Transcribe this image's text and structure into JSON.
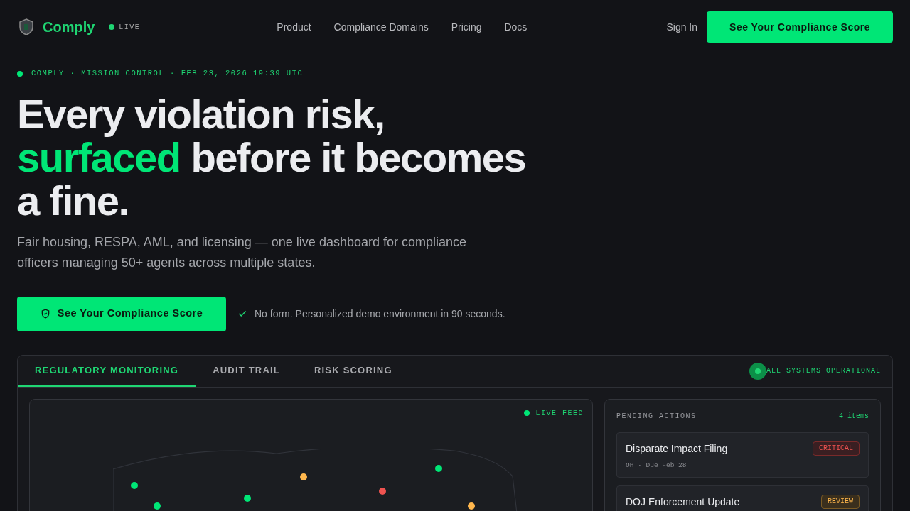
{
  "nav": {
    "brand": "Comply",
    "live_badge": "LIVE",
    "links": [
      "Product",
      "Compliance Domains",
      "Pricing",
      "Docs"
    ],
    "sign_in": "Sign In",
    "cta": "See Your Compliance Score"
  },
  "hero": {
    "eyebrow": "COMPLY · MISSION CONTROL · FEB 23, 2026 19:39 UTC",
    "headline": [
      {
        "parts": [
          {
            "text": "Every violation risk,",
            "accent": false
          }
        ]
      },
      {
        "parts": [
          {
            "text": "surfaced",
            "accent": true
          },
          {
            "text": " before it becomes",
            "accent": false
          }
        ]
      },
      {
        "parts": [
          {
            "text": "a fine.",
            "accent": false
          }
        ]
      }
    ],
    "subtitle": "Fair housing, RESPA, AML, and licensing — one live dashboard for compliance officers managing 50+ agents across multiple states.",
    "cta": "See Your Compliance Score",
    "note": "No form. Personalized demo environment in 90 seconds."
  },
  "dashboard": {
    "tabs": [
      {
        "label": "REGULATORY MONITORING",
        "selected": true
      },
      {
        "label": "AUDIT TRAIL",
        "selected": false
      },
      {
        "label": "RISK SCORING",
        "selected": false
      }
    ],
    "status": "ALL SYSTEMS OPERATIONAL",
    "map": {
      "feed_label": "LIVE FEED",
      "markers": [
        {
          "color": "#00e676"
        },
        {
          "color": "#00e676"
        },
        {
          "color": "#00e676"
        },
        {
          "color": "#ffb74d"
        },
        {
          "color": "#ef5350"
        },
        {
          "color": "#00e676"
        },
        {
          "color": "#ffb74d"
        }
      ]
    },
    "pending": {
      "title": "PENDING ACTIONS",
      "count": "4 items",
      "items": [
        {
          "title": "Disparate Impact Filing",
          "meta": "OH · Due Feb 28",
          "status": "CRITICAL",
          "kind": "critical"
        },
        {
          "title": "DOJ Enforcement Update",
          "status": "REVIEW",
          "kind": "review"
        }
      ]
    }
  }
}
